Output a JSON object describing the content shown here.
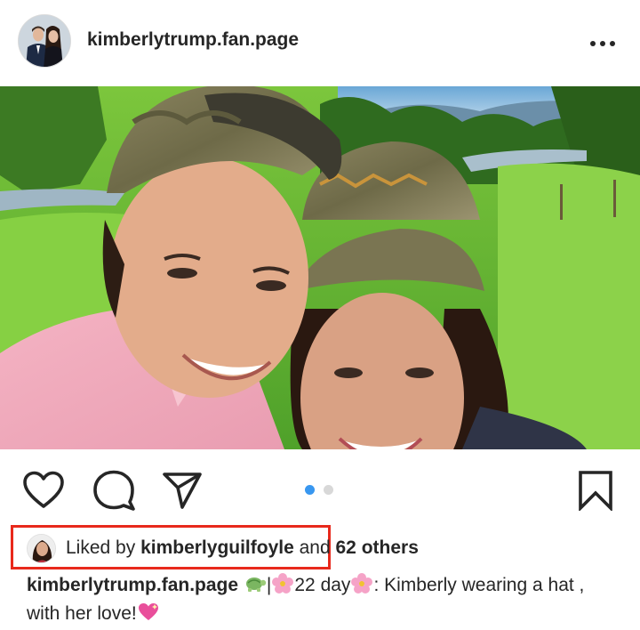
{
  "post": {
    "username": "kimberlytrump.fan.page",
    "more_label": "•••",
    "photo_alt": "",
    "carousel": {
      "count": 2,
      "active_index": 0
    }
  },
  "colors": {
    "accent_blue": "#3897f0",
    "inactive_dot": "#d8d8d8",
    "highlight_box": "#e8291c",
    "text": "#262626"
  },
  "icons": {
    "like": "heart-icon",
    "comment": "comment-icon",
    "share": "paper-plane-icon",
    "save": "bookmark-icon",
    "more": "ellipsis-icon"
  },
  "likes": {
    "prefix": "Liked by ",
    "user": "kimberlyguilfoyle",
    "middle": " and ",
    "others": "62 others"
  },
  "caption": {
    "user": "kimberlytrump.fan.page",
    "sep": "|",
    "text_1": "22 day",
    "text_2": ": Kimberly wearing a hat , with her love!"
  }
}
